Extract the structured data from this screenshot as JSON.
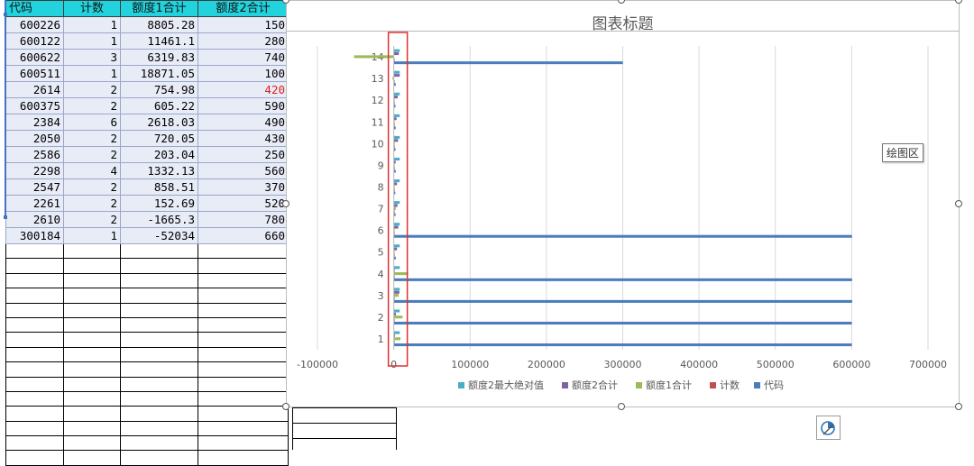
{
  "sheet": {
    "headers": [
      "代码",
      "计数",
      "额度1合计",
      "额度2合计"
    ],
    "rows": [
      [
        "600226",
        "1",
        "8805.28",
        "150"
      ],
      [
        "600122",
        "1",
        "11461.1",
        "280"
      ],
      [
        "600622",
        "3",
        "6319.83",
        "740"
      ],
      [
        "600511",
        "1",
        "18871.05",
        "100"
      ],
      [
        "2614",
        "2",
        "754.98",
        "420"
      ],
      [
        "600375",
        "2",
        "605.22",
        "590"
      ],
      [
        "2384",
        "6",
        "2618.03",
        "490"
      ],
      [
        "2050",
        "2",
        "720.05",
        "430"
      ],
      [
        "2586",
        "2",
        "203.04",
        "250"
      ],
      [
        "2298",
        "4",
        "1332.13",
        "560"
      ],
      [
        "2547",
        "2",
        "858.51",
        "370"
      ],
      [
        "2261",
        "2",
        "152.69",
        "520"
      ],
      [
        "2610",
        "2",
        "-1665.3",
        "780"
      ],
      [
        "300184",
        "1",
        "-52034",
        "660"
      ]
    ],
    "red_cell_row": 4
  },
  "chart": {
    "tooltip": "绘图区"
  },
  "colors": {
    "header_bg": "#22d3de",
    "series_code": "#4a7ebb",
    "series_count": "#c0504d",
    "series_sum1": "#9bbb59",
    "series_sum2": "#8064a2",
    "series_absmax": "#4bacc6",
    "highlight_box": "#e03030"
  },
  "chart_data": {
    "type": "bar",
    "orientation": "horizontal",
    "title": "图表标题",
    "categories": [
      "1",
      "2",
      "3",
      "4",
      "5",
      "6",
      "7",
      "8",
      "9",
      "10",
      "11",
      "12",
      "13",
      "14"
    ],
    "xlim": [
      -100000,
      700000
    ],
    "xticks": [
      -100000,
      0,
      100000,
      200000,
      300000,
      400000,
      500000,
      600000,
      700000
    ],
    "grid": true,
    "legend_position": "bottom",
    "series": [
      {
        "name": "代码",
        "values": [
          600226,
          600122,
          600622,
          600511,
          2614,
          600375,
          2384,
          2050,
          2586,
          2298,
          2547,
          2261,
          2610,
          300184
        ]
      },
      {
        "name": "计数",
        "values": [
          1,
          1,
          3,
          1,
          2,
          2,
          6,
          2,
          2,
          4,
          2,
          2,
          2,
          1
        ]
      },
      {
        "name": "额度1合计",
        "values": [
          8805.28,
          11461.1,
          6319.83,
          18871.05,
          754.98,
          605.22,
          2618.03,
          720.05,
          203.04,
          1332.13,
          858.51,
          152.69,
          -1665.3,
          -52034
        ]
      },
      {
        "name": "额度2合计",
        "values": [
          1500,
          2800,
          7400,
          1000,
          4200,
          5900,
          4900,
          4300,
          2500,
          5600,
          3700,
          5200,
          7800,
          6600
        ]
      },
      {
        "name": "额度2最大绝对值",
        "values": [
          7800,
          7800,
          7800,
          7800,
          7800,
          7800,
          7800,
          7800,
          7800,
          7800,
          7800,
          7800,
          7800,
          7800
        ]
      }
    ],
    "legend_order": [
      "额度2最大绝对值",
      "额度2合计",
      "额度1合计",
      "计数",
      "代码"
    ]
  }
}
